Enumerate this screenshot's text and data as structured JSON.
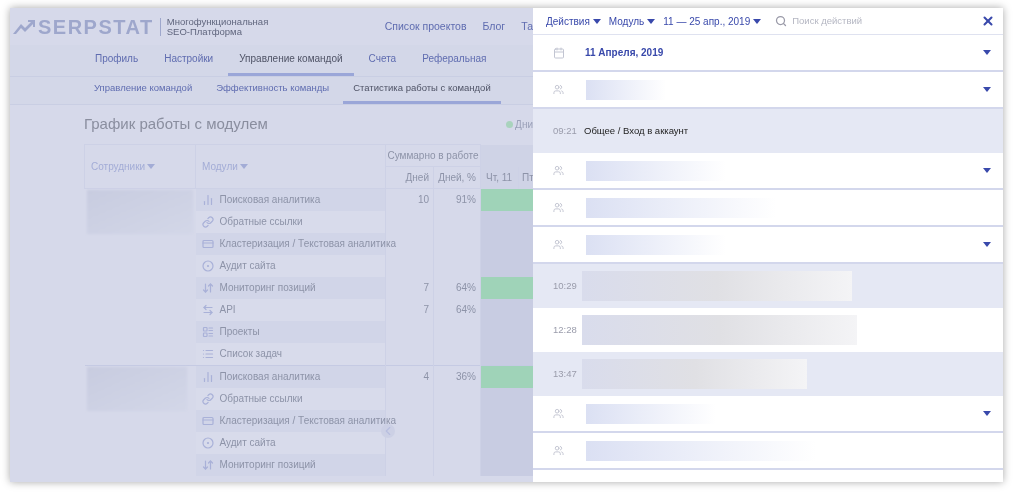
{
  "header": {
    "logo": "SERPSTAT",
    "tagline": [
      "Многофункциональная",
      "SEO-Платформа"
    ],
    "nav": [
      "Список проектов",
      "Блог",
      "Та"
    ]
  },
  "tabs": [
    {
      "label": "Профиль",
      "selected": false
    },
    {
      "label": "Настройки",
      "selected": false
    },
    {
      "label": "Управление командой",
      "selected": true
    },
    {
      "label": "Счета",
      "selected": false
    },
    {
      "label": "Реферальная",
      "selected": false
    }
  ],
  "subtabs": [
    {
      "label": "Управление командой",
      "selected": false
    },
    {
      "label": "Эффективность команды",
      "selected": false
    },
    {
      "label": "Статистика работы с командой",
      "selected": true
    }
  ],
  "section": {
    "title": "График работы с модулем",
    "legend": "Дни"
  },
  "table": {
    "columns": {
      "employees": "Сотрудники",
      "modules": "Модули",
      "total": "Суммарно в работе",
      "days": "Дней",
      "percent": "Дней, %",
      "day_1": "Чт, 11",
      "day_2": "Пт"
    },
    "groups": [
      {
        "rows": [
          {
            "kind": "search",
            "module": "Поисковая аналитика",
            "days": "10",
            "percent": "91%",
            "active": true
          },
          {
            "kind": "links",
            "module": "Обратные ссылки",
            "active": false
          },
          {
            "kind": "cluster",
            "module": "Кластеризация / Текстовая аналитика",
            "active": false
          },
          {
            "kind": "audit",
            "module": "Аудит сайта",
            "active": false
          },
          {
            "kind": "monitoring",
            "module": "Мониторинг позиций",
            "days": "7",
            "percent": "64%",
            "active": true
          },
          {
            "kind": "api",
            "module": "API",
            "days": "7",
            "percent": "64%",
            "active": false
          },
          {
            "kind": "projects",
            "module": "Проекты",
            "active": false
          },
          {
            "kind": "tasks",
            "module": "Список задач",
            "active": false
          }
        ]
      },
      {
        "rows": [
          {
            "kind": "search",
            "module": "Поисковая аналитика",
            "days": "4",
            "percent": "36%",
            "active": true
          },
          {
            "kind": "links",
            "module": "Обратные ссылки",
            "active": false
          },
          {
            "kind": "cluster",
            "module": "Кластеризация / Текстовая аналитика",
            "active": false
          },
          {
            "kind": "audit",
            "module": "Аудит сайта",
            "active": false
          },
          {
            "kind": "monitoring",
            "module": "Мониторинг позиций",
            "active": false
          }
        ]
      }
    ]
  },
  "panel": {
    "filters": [
      {
        "label": "Действия"
      },
      {
        "label": "Модуль"
      },
      {
        "label": "11 — 25 апр., 2019"
      }
    ],
    "search": {
      "placeholder": "Поиск действий"
    },
    "date": "11 Апреля, 2019",
    "entries": [
      {
        "kind": "user",
        "expandable": true
      },
      {
        "kind": "action",
        "time": "09:21",
        "text": "Общее / Вход в аккаунт",
        "shaded": true
      },
      {
        "kind": "user",
        "expandable": true
      },
      {
        "kind": "user",
        "expandable": false
      },
      {
        "kind": "user",
        "expandable": true
      },
      {
        "kind": "action",
        "time": "10:29",
        "shaded": true
      },
      {
        "kind": "action",
        "time": "12:28",
        "shaded": false
      },
      {
        "kind": "action",
        "time": "13:47",
        "shaded": true
      },
      {
        "kind": "user",
        "expandable": true
      },
      {
        "kind": "user",
        "expandable": false
      }
    ]
  }
}
